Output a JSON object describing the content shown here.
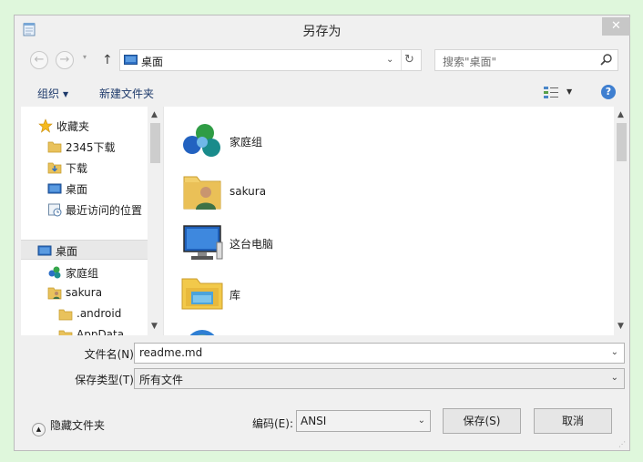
{
  "window": {
    "title": "另存为",
    "close_glyph": "✕"
  },
  "nav": {
    "back_glyph": "←",
    "forward_glyph": "→",
    "recent_glyph": "▾",
    "up_glyph": "↑",
    "address": "桌面",
    "address_arrow": "⌄",
    "refresh_glyph": "↻",
    "search_placeholder": "搜索\"桌面\""
  },
  "toolbar": {
    "organize": "组织",
    "organize_arrow": "▼",
    "new_folder": "新建文件夹",
    "view_arrow": "▼",
    "help_glyph": "?"
  },
  "sidebar": {
    "items": [
      {
        "label": "收藏夹",
        "icon": "star-icon"
      },
      {
        "label": "2345下载",
        "icon": "folder-icon"
      },
      {
        "label": "下载",
        "icon": "downloads-folder-icon"
      },
      {
        "label": "桌面",
        "icon": "desktop-icon"
      },
      {
        "label": "最近访问的位置",
        "icon": "recent-places-icon"
      },
      {
        "label": "桌面",
        "icon": "desktop-icon",
        "selected": true
      },
      {
        "label": "家庭组",
        "icon": "homegroup-icon"
      },
      {
        "label": "sakura",
        "icon": "user-folder-icon"
      },
      {
        "label": ".android",
        "icon": "folder-icon"
      },
      {
        "label": "AppData",
        "icon": "folder-icon"
      }
    ]
  },
  "files": [
    {
      "label": "家庭组",
      "icon": "homegroup-icon"
    },
    {
      "label": "sakura",
      "icon": "user-folder-icon"
    },
    {
      "label": "这台电脑",
      "icon": "computer-icon"
    },
    {
      "label": "库",
      "icon": "library-icon"
    },
    {
      "label": "",
      "icon": "network-icon"
    }
  ],
  "form": {
    "filename_label": "文件名(N):",
    "filename_value": "readme.md",
    "filetype_label": "保存类型(T):",
    "filetype_value": "所有文件",
    "dropdown_arrow": "⌄"
  },
  "footer": {
    "hide_folders": "隐藏文件夹",
    "hide_glyph": "▲",
    "encoding_label": "编码(E):",
    "encoding_value": "ANSI",
    "encoding_arrow": "⌄",
    "save": "保存(S)",
    "cancel": "取消",
    "grip": "⋰"
  },
  "scroll_glyphs": {
    "up": "▲",
    "down": "▼"
  },
  "colors": {
    "accent": "#3f7fd0",
    "background": "#dff7dc",
    "window": "#f0f0f0"
  }
}
